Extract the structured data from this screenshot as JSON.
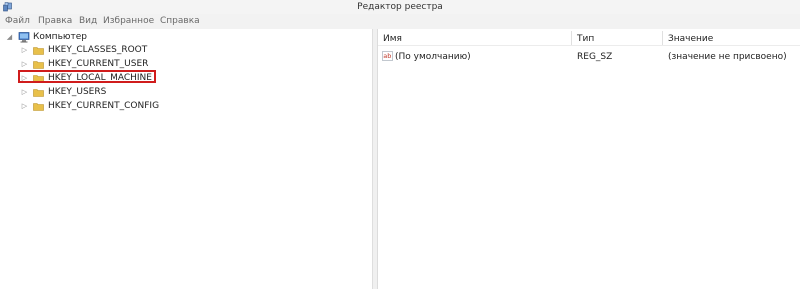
{
  "window": {
    "title": "Редактор реестра"
  },
  "menu": [
    "Файл",
    "Правка",
    "Вид",
    "Избранное",
    "Справка"
  ],
  "tree": {
    "root": "Компьютер",
    "nodes": [
      "HKEY_CLASSES_ROOT",
      "HKEY_CURRENT_USER",
      "HKEY_LOCAL_MACHINE",
      "HKEY_USERS",
      "HKEY_CURRENT_CONFIG"
    ],
    "highlighted": "HKEY_LOCAL_MACHINE"
  },
  "list": {
    "columns": [
      "Имя",
      "Тип",
      "Значение"
    ],
    "rows": [
      {
        "name": "(По умолчанию)",
        "type": "REG_SZ",
        "value": "(значение не присвоено)"
      }
    ]
  },
  "colors": {
    "highlight_border": "#d01c1c",
    "folder": "#e8c04a"
  },
  "icons": {
    "app": "registry-editor-icon",
    "root": "computer-icon",
    "node": "folder-icon",
    "value": "string-value-icon"
  }
}
